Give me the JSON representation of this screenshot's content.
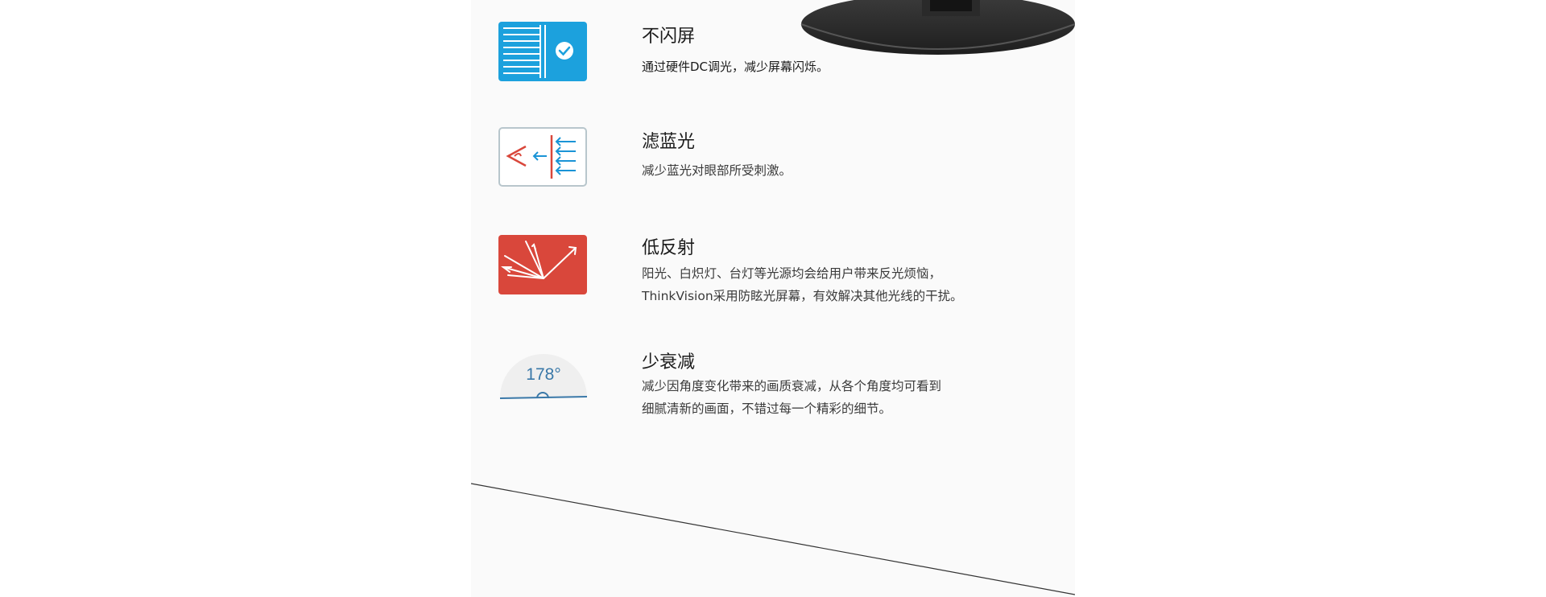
{
  "features": [
    {
      "icon": "flicker-free-icon",
      "title": "不闪屏",
      "desc": [
        "通过硬件DC调光，减少屏幕闪烁。"
      ],
      "color": "#1ca1dd"
    },
    {
      "icon": "blue-light-filter-icon",
      "title": "滤蓝光",
      "desc": [
        "减少蓝光对眼部所受刺激。"
      ],
      "color": "#1a94d6"
    },
    {
      "icon": "anti-glare-icon",
      "title": "低反射",
      "desc": [
        "阳光、白炽灯、台灯等光源均会给用户带来反光烦恼，",
        "ThinkVision采用防眩光屏幕，有效解决其他光线的干扰。"
      ],
      "color": "#d9473b"
    },
    {
      "icon": "viewing-angle-icon",
      "title": "少衰减",
      "desc": [
        "减少因角度变化带来的画质衰减，从各个角度均可看到",
        "细腻清新的画面，不错过每一个精彩的细节。"
      ],
      "angle_label": "178°",
      "color": "#3a78a8"
    }
  ]
}
